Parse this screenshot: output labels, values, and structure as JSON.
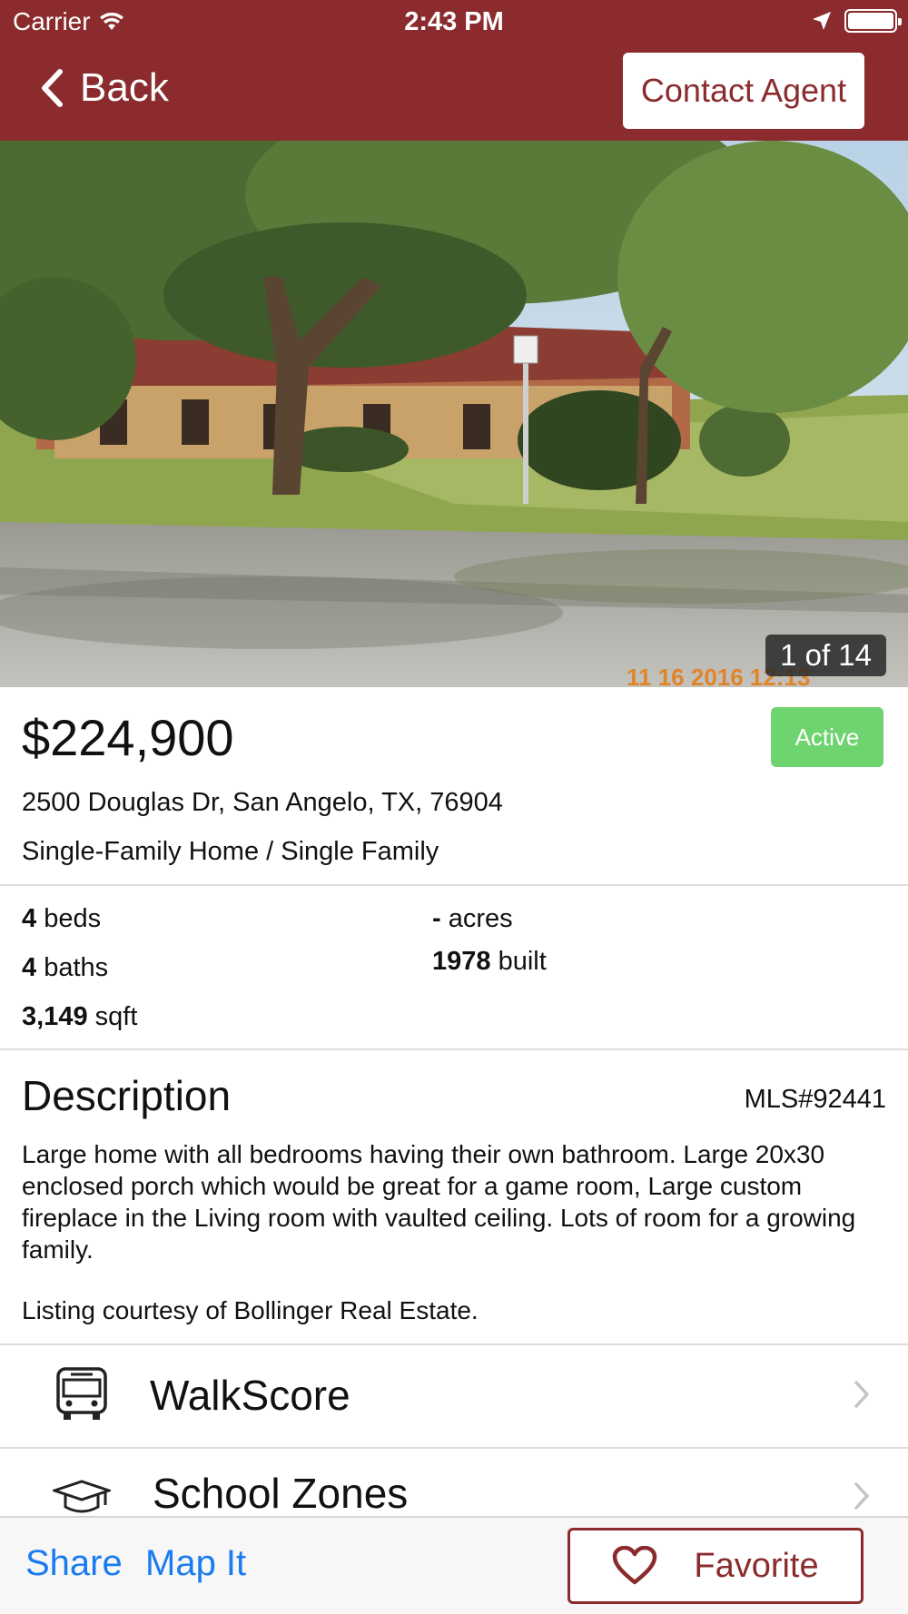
{
  "status_bar": {
    "carrier": "Carrier",
    "time": "2:43 PM"
  },
  "nav": {
    "back_label": "Back",
    "contact_label": "Contact Agent"
  },
  "photo": {
    "counter": "1 of 14",
    "timestamp": "11 16 2016 12:13"
  },
  "listing": {
    "price": "$224,900",
    "status": "Active",
    "address": "2500 Douglas Dr, San Angelo, TX, 76904",
    "property_type": "Single-Family Home / Single Family"
  },
  "stats": {
    "beds_value": "4",
    "beds_unit": "beds",
    "baths_value": "4",
    "baths_unit": "baths",
    "sqft_value": "3,149",
    "sqft_unit": "sqft",
    "acres_value": "-",
    "acres_unit": "acres",
    "built_value": "1978",
    "built_unit": "built"
  },
  "description": {
    "title": "Description",
    "mls": "MLS#92441",
    "body": "Large home with all bedrooms having their own bathroom. Large 20x30 enclosed porch which would be great for a game room, Large custom fireplace in the Living room with vaulted ceiling.  Lots of room for a growing family.",
    "courtesy": "Listing courtesy of Bollinger Real Estate."
  },
  "rows": [
    {
      "label": "WalkScore",
      "icon": "bus-icon"
    },
    {
      "label": "School Zones",
      "icon": "graduation-cap-icon"
    }
  ],
  "toolbar": {
    "share_label": "Share",
    "mapit_label": "Map It",
    "favorite_label": "Favorite"
  },
  "colors": {
    "brand": "#8b2b2d",
    "active_badge": "#6ed46f",
    "link": "#1a7cf0"
  }
}
